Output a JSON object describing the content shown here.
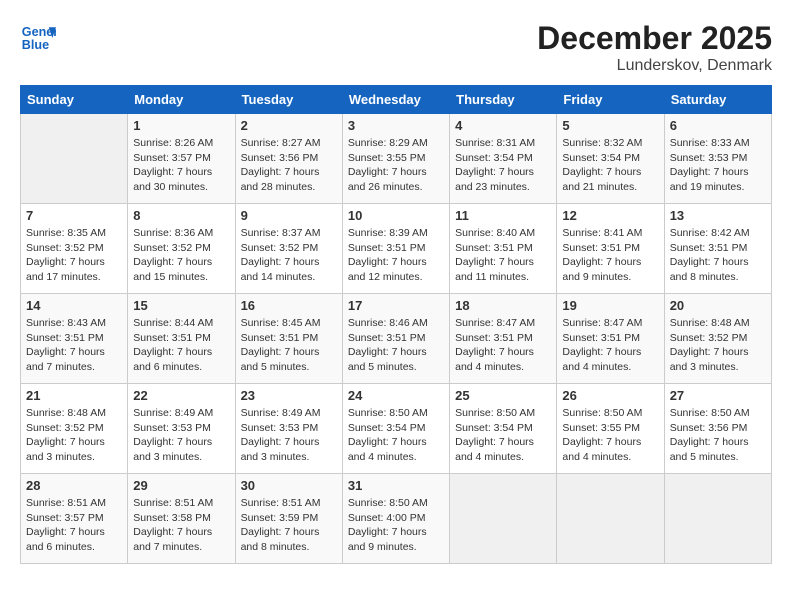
{
  "header": {
    "logo_line1": "General",
    "logo_line2": "Blue",
    "month": "December 2025",
    "location": "Lunderskov, Denmark"
  },
  "days_of_week": [
    "Sunday",
    "Monday",
    "Tuesday",
    "Wednesday",
    "Thursday",
    "Friday",
    "Saturday"
  ],
  "weeks": [
    [
      {
        "num": "",
        "sunrise": "",
        "sunset": "",
        "daylight": "",
        "empty": true
      },
      {
        "num": "1",
        "sunrise": "Sunrise: 8:26 AM",
        "sunset": "Sunset: 3:57 PM",
        "daylight": "Daylight: 7 hours and 30 minutes."
      },
      {
        "num": "2",
        "sunrise": "Sunrise: 8:27 AM",
        "sunset": "Sunset: 3:56 PM",
        "daylight": "Daylight: 7 hours and 28 minutes."
      },
      {
        "num": "3",
        "sunrise": "Sunrise: 8:29 AM",
        "sunset": "Sunset: 3:55 PM",
        "daylight": "Daylight: 7 hours and 26 minutes."
      },
      {
        "num": "4",
        "sunrise": "Sunrise: 8:31 AM",
        "sunset": "Sunset: 3:54 PM",
        "daylight": "Daylight: 7 hours and 23 minutes."
      },
      {
        "num": "5",
        "sunrise": "Sunrise: 8:32 AM",
        "sunset": "Sunset: 3:54 PM",
        "daylight": "Daylight: 7 hours and 21 minutes."
      },
      {
        "num": "6",
        "sunrise": "Sunrise: 8:33 AM",
        "sunset": "Sunset: 3:53 PM",
        "daylight": "Daylight: 7 hours and 19 minutes."
      }
    ],
    [
      {
        "num": "7",
        "sunrise": "Sunrise: 8:35 AM",
        "sunset": "Sunset: 3:52 PM",
        "daylight": "Daylight: 7 hours and 17 minutes."
      },
      {
        "num": "8",
        "sunrise": "Sunrise: 8:36 AM",
        "sunset": "Sunset: 3:52 PM",
        "daylight": "Daylight: 7 hours and 15 minutes."
      },
      {
        "num": "9",
        "sunrise": "Sunrise: 8:37 AM",
        "sunset": "Sunset: 3:52 PM",
        "daylight": "Daylight: 7 hours and 14 minutes."
      },
      {
        "num": "10",
        "sunrise": "Sunrise: 8:39 AM",
        "sunset": "Sunset: 3:51 PM",
        "daylight": "Daylight: 7 hours and 12 minutes."
      },
      {
        "num": "11",
        "sunrise": "Sunrise: 8:40 AM",
        "sunset": "Sunset: 3:51 PM",
        "daylight": "Daylight: 7 hours and 11 minutes."
      },
      {
        "num": "12",
        "sunrise": "Sunrise: 8:41 AM",
        "sunset": "Sunset: 3:51 PM",
        "daylight": "Daylight: 7 hours and 9 minutes."
      },
      {
        "num": "13",
        "sunrise": "Sunrise: 8:42 AM",
        "sunset": "Sunset: 3:51 PM",
        "daylight": "Daylight: 7 hours and 8 minutes."
      }
    ],
    [
      {
        "num": "14",
        "sunrise": "Sunrise: 8:43 AM",
        "sunset": "Sunset: 3:51 PM",
        "daylight": "Daylight: 7 hours and 7 minutes."
      },
      {
        "num": "15",
        "sunrise": "Sunrise: 8:44 AM",
        "sunset": "Sunset: 3:51 PM",
        "daylight": "Daylight: 7 hours and 6 minutes."
      },
      {
        "num": "16",
        "sunrise": "Sunrise: 8:45 AM",
        "sunset": "Sunset: 3:51 PM",
        "daylight": "Daylight: 7 hours and 5 minutes."
      },
      {
        "num": "17",
        "sunrise": "Sunrise: 8:46 AM",
        "sunset": "Sunset: 3:51 PM",
        "daylight": "Daylight: 7 hours and 5 minutes."
      },
      {
        "num": "18",
        "sunrise": "Sunrise: 8:47 AM",
        "sunset": "Sunset: 3:51 PM",
        "daylight": "Daylight: 7 hours and 4 minutes."
      },
      {
        "num": "19",
        "sunrise": "Sunrise: 8:47 AM",
        "sunset": "Sunset: 3:51 PM",
        "daylight": "Daylight: 7 hours and 4 minutes."
      },
      {
        "num": "20",
        "sunrise": "Sunrise: 8:48 AM",
        "sunset": "Sunset: 3:52 PM",
        "daylight": "Daylight: 7 hours and 3 minutes."
      }
    ],
    [
      {
        "num": "21",
        "sunrise": "Sunrise: 8:48 AM",
        "sunset": "Sunset: 3:52 PM",
        "daylight": "Daylight: 7 hours and 3 minutes."
      },
      {
        "num": "22",
        "sunrise": "Sunrise: 8:49 AM",
        "sunset": "Sunset: 3:53 PM",
        "daylight": "Daylight: 7 hours and 3 minutes."
      },
      {
        "num": "23",
        "sunrise": "Sunrise: 8:49 AM",
        "sunset": "Sunset: 3:53 PM",
        "daylight": "Daylight: 7 hours and 3 minutes."
      },
      {
        "num": "24",
        "sunrise": "Sunrise: 8:50 AM",
        "sunset": "Sunset: 3:54 PM",
        "daylight": "Daylight: 7 hours and 4 minutes."
      },
      {
        "num": "25",
        "sunrise": "Sunrise: 8:50 AM",
        "sunset": "Sunset: 3:54 PM",
        "daylight": "Daylight: 7 hours and 4 minutes."
      },
      {
        "num": "26",
        "sunrise": "Sunrise: 8:50 AM",
        "sunset": "Sunset: 3:55 PM",
        "daylight": "Daylight: 7 hours and 4 minutes."
      },
      {
        "num": "27",
        "sunrise": "Sunrise: 8:50 AM",
        "sunset": "Sunset: 3:56 PM",
        "daylight": "Daylight: 7 hours and 5 minutes."
      }
    ],
    [
      {
        "num": "28",
        "sunrise": "Sunrise: 8:51 AM",
        "sunset": "Sunset: 3:57 PM",
        "daylight": "Daylight: 7 hours and 6 minutes."
      },
      {
        "num": "29",
        "sunrise": "Sunrise: 8:51 AM",
        "sunset": "Sunset: 3:58 PM",
        "daylight": "Daylight: 7 hours and 7 minutes."
      },
      {
        "num": "30",
        "sunrise": "Sunrise: 8:51 AM",
        "sunset": "Sunset: 3:59 PM",
        "daylight": "Daylight: 7 hours and 8 minutes."
      },
      {
        "num": "31",
        "sunrise": "Sunrise: 8:50 AM",
        "sunset": "Sunset: 4:00 PM",
        "daylight": "Daylight: 7 hours and 9 minutes."
      },
      {
        "num": "",
        "sunrise": "",
        "sunset": "",
        "daylight": "",
        "empty": true
      },
      {
        "num": "",
        "sunrise": "",
        "sunset": "",
        "daylight": "",
        "empty": true
      },
      {
        "num": "",
        "sunrise": "",
        "sunset": "",
        "daylight": "",
        "empty": true
      }
    ]
  ]
}
